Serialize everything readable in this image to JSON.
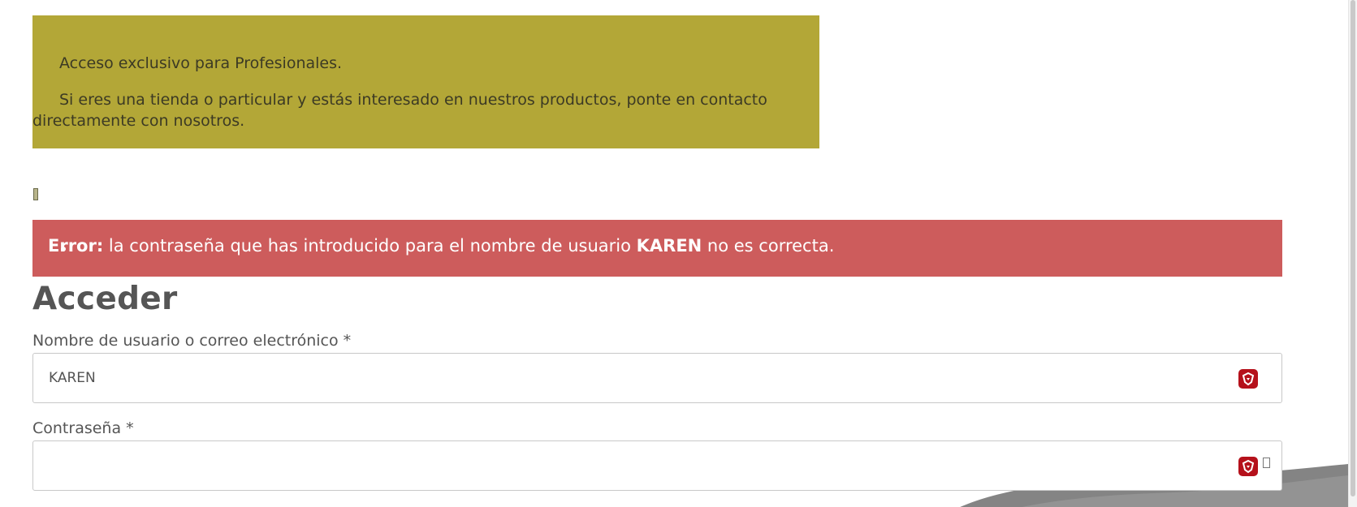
{
  "notice": {
    "line1": "Acceso exclusivo para Profesionales.",
    "line2": "Si eres una tienda o particular y estás interesado en nuestros productos, ponte en contacto directamente con nosotros."
  },
  "error": {
    "prefix": "Error:",
    "text_before_user": " la contraseña que has introducido para el nombre de usuario ",
    "username": "KAREN",
    "text_after_user": " no es correcta."
  },
  "login": {
    "heading": "Acceder",
    "username_label": "Nombre de usuario o correo electrónico *",
    "username_value": "KAREN",
    "password_label": "Contraseña *",
    "password_value": ""
  },
  "colors": {
    "notice_bg": "#b3a737",
    "error_bg": "#cd5c5c",
    "password_manager_icon": "#b5111b"
  },
  "icons": {
    "password_manager": "password-manager-icon",
    "show_password": "show-password-icon"
  }
}
